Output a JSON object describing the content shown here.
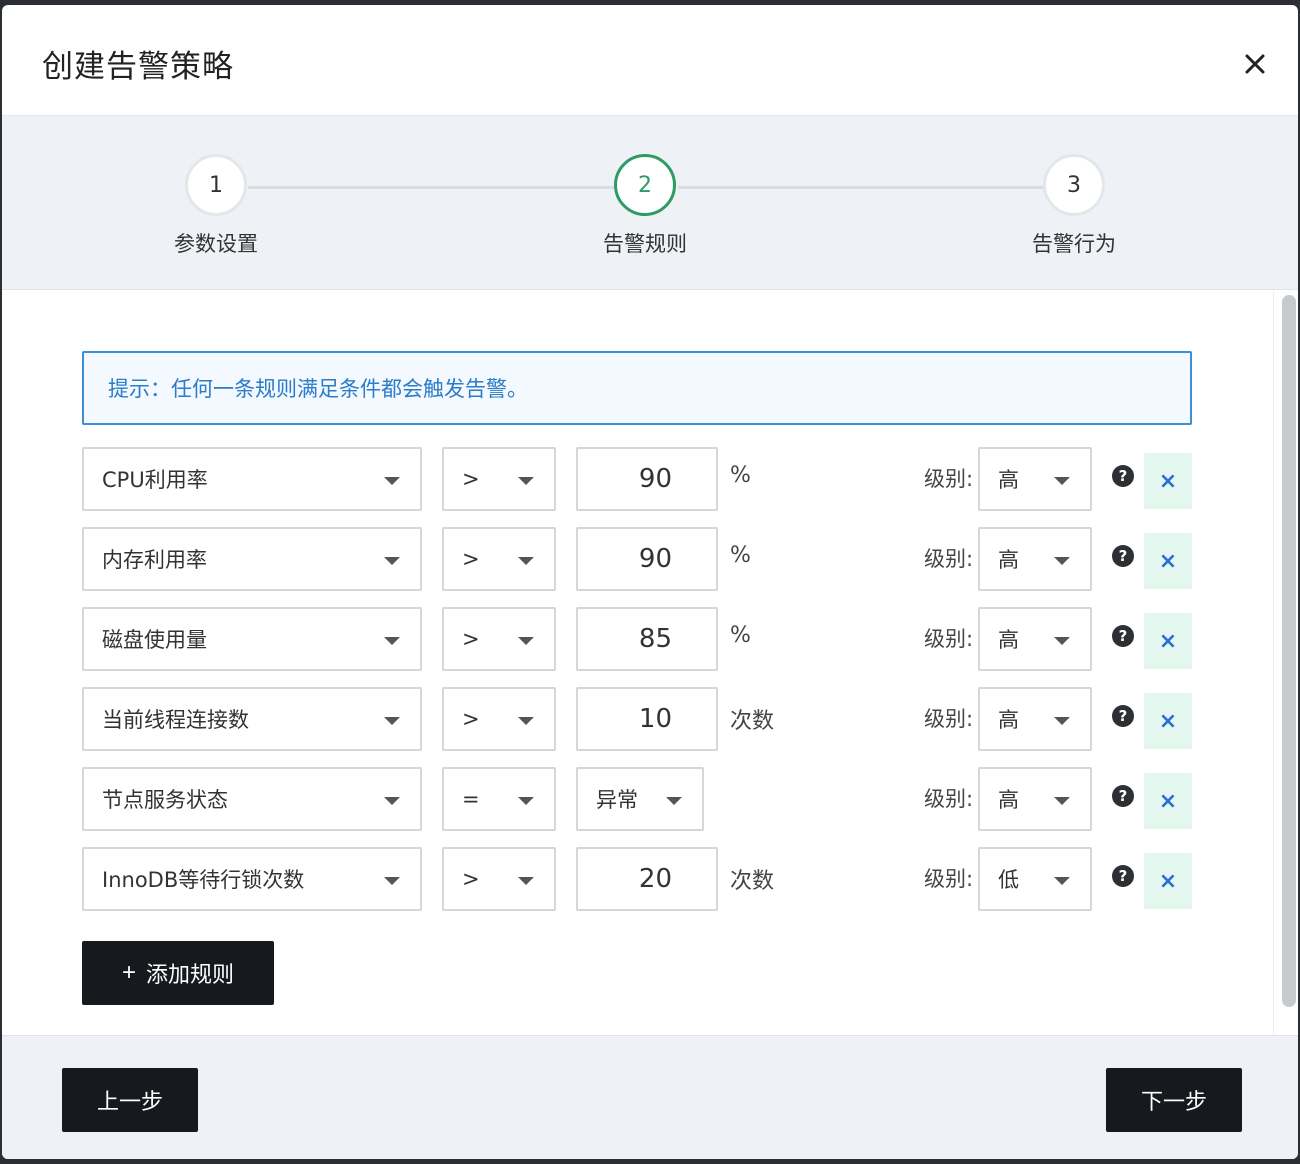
{
  "dialog": {
    "title": "创建告警策略"
  },
  "steps": [
    {
      "num": "1",
      "label": "参数设置",
      "active": false
    },
    {
      "num": "2",
      "label": "告警规则",
      "active": true
    },
    {
      "num": "3",
      "label": "告警行为",
      "active": false
    }
  ],
  "hint": "提示：任何一条规则满足条件都会触发告警。",
  "level_label": "级别:",
  "rules": [
    {
      "metric": "CPU利用率",
      "operator": ">",
      "value": "90",
      "unit": "%",
      "level": "高"
    },
    {
      "metric": "内存利用率",
      "operator": ">",
      "value": "90",
      "unit": "%",
      "level": "高"
    },
    {
      "metric": "磁盘使用量",
      "operator": ">",
      "value": "85",
      "unit": "%",
      "level": "高"
    },
    {
      "metric": "当前线程连接数",
      "operator": ">",
      "value": "10",
      "unit": "次数",
      "level": "高"
    },
    {
      "metric": "节点服务状态",
      "operator": "=",
      "value_select": "异常",
      "unit": "",
      "level": "高"
    },
    {
      "metric": "InnoDB等待行锁次数",
      "operator": ">",
      "value": "20",
      "unit": "次数",
      "level": "低"
    }
  ],
  "add_rule_label": "添加规则",
  "footer": {
    "prev_label": "上一步",
    "next_label": "下一步"
  },
  "colors": {
    "active_step": "#2e9b64",
    "hint_border": "#3b8fd4",
    "hint_text": "#2b7cc9",
    "delete_bg": "#e3f7ee",
    "dark_button": "#161a1e"
  }
}
